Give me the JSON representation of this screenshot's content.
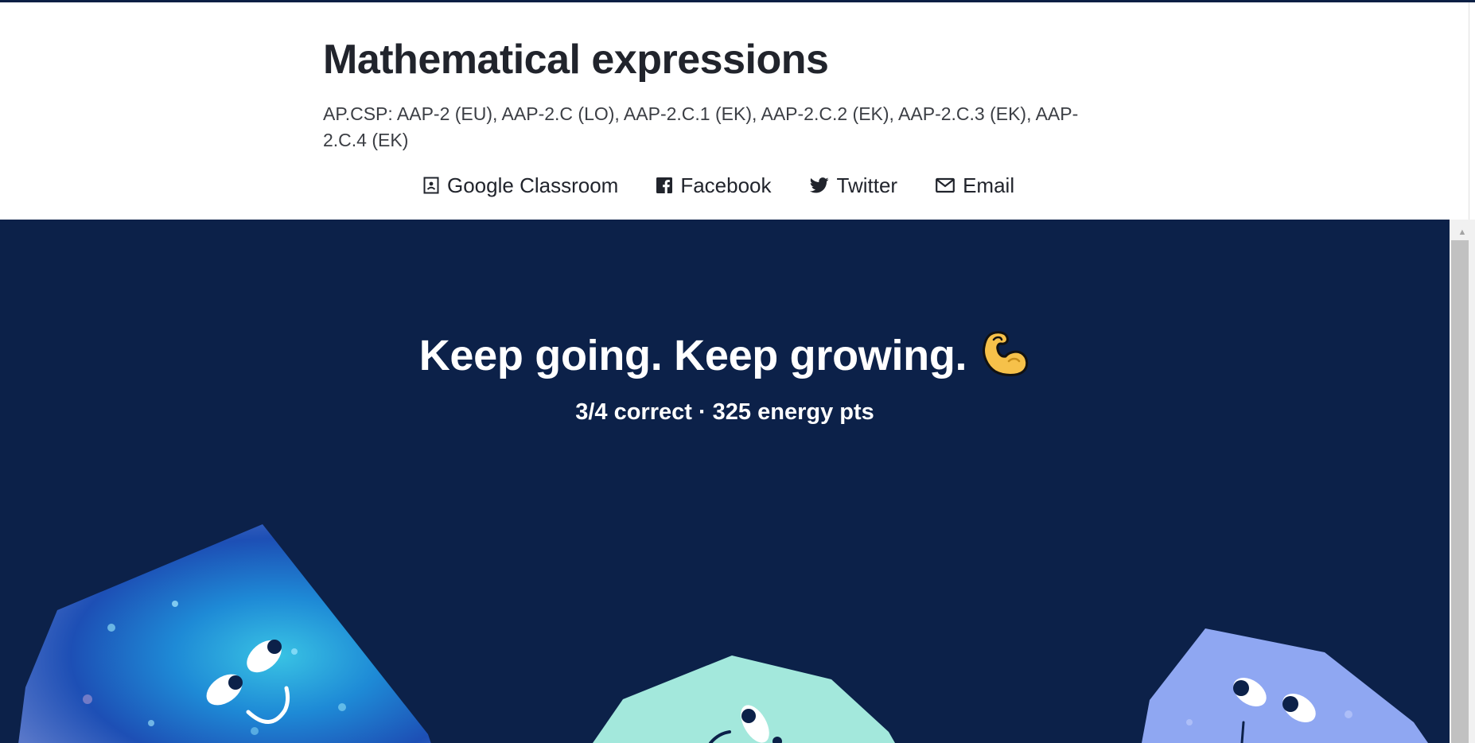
{
  "page": {
    "title": "Mathematical expressions",
    "standards": "AP.CSP: AAP-2 (EU), AAP-2.C (LO), AAP-2.C.1 (EK), AAP-2.C.2 (EK), AAP-2.C.3 (EK), AAP-2.C.4 (EK)"
  },
  "share": {
    "items": [
      {
        "label": "Google Classroom",
        "icon": "google-classroom-icon"
      },
      {
        "label": "Facebook",
        "icon": "facebook-icon"
      },
      {
        "label": "Twitter",
        "icon": "twitter-icon"
      },
      {
        "label": "Email",
        "icon": "email-icon"
      }
    ]
  },
  "results": {
    "headline": "Keep going. Keep growing.",
    "headline_emoji": "flexed-biceps-icon",
    "score": "3/4 correct · 325 energy pts"
  },
  "colors": {
    "hero_background": "#0c2149",
    "title_text": "#21242c",
    "creature_left": "#2a64c8",
    "creature_middle": "#a3e8dc",
    "creature_right": "#8fa7f2"
  }
}
